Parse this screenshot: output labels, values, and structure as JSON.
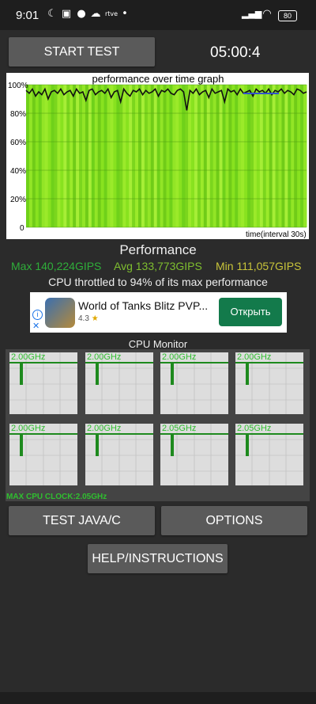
{
  "status_bar": {
    "time": "9:01",
    "battery": "80"
  },
  "buttons": {
    "start_test": "START TEST",
    "test_java_c": "TEST JAVA/C",
    "options": "OPTIONS",
    "help": "HELP/INSTRUCTIONS"
  },
  "timer": "05:00:4",
  "graph": {
    "title": "performance over time graph",
    "y_ticks": [
      "100%",
      "80%",
      "60%",
      "40%",
      "20%",
      "0"
    ],
    "x_label": "time(interval 30s)"
  },
  "performance": {
    "title": "Performance",
    "max": "Max 140,224GIPS",
    "avg": "Avg 133,773GIPS",
    "min": "Min 111,057GIPS",
    "throttle": "CPU throttled to 94% of its max performance",
    "colors": {
      "max": "#2fae3a",
      "avg": "#7fbf2f",
      "min": "#c8c43a"
    }
  },
  "ad": {
    "title": "World of Tanks Blitz PVP...",
    "rating": "4.3",
    "button": "Открыть"
  },
  "cpu_monitor": {
    "title": "CPU Monitor",
    "cores": [
      {
        "freq": "2.00GHz"
      },
      {
        "freq": "2.00GHz"
      },
      {
        "freq": "2.00GHz"
      },
      {
        "freq": "2.00GHz"
      },
      {
        "freq": "2.00GHz"
      },
      {
        "freq": "2.00GHz"
      },
      {
        "freq": "2.05GHz"
      },
      {
        "freq": "2.05GHz"
      }
    ],
    "max_clock": "MAX CPU CLOCK:2.05GHz"
  },
  "chart_data": {
    "type": "line",
    "title": "performance over time graph",
    "xlabel": "time(interval 30s)",
    "ylabel": "",
    "ylim": [
      0,
      100
    ],
    "y_ticks": [
      "100%",
      "80%",
      "60%",
      "40%",
      "20%",
      "0"
    ],
    "series": [
      {
        "values": [
          96,
          94,
          97,
          92,
          95,
          93,
          97,
          90,
          95,
          96,
          94,
          97,
          93,
          95,
          96,
          92,
          97,
          94,
          95,
          89,
          96,
          97,
          93,
          95,
          96,
          94,
          97,
          91,
          95,
          96,
          88,
          97,
          94,
          92,
          96,
          95,
          97,
          93,
          96,
          94,
          95,
          97,
          92,
          96,
          95,
          97,
          94,
          93,
          96,
          97,
          95,
          82,
          96,
          94,
          97,
          93,
          95,
          96,
          91,
          97,
          94,
          95,
          96,
          88,
          97,
          95,
          96,
          93,
          97,
          94,
          95,
          96,
          92,
          97,
          95,
          96,
          94,
          97,
          93,
          96,
          95,
          97,
          94,
          96,
          95,
          93,
          97,
          96,
          94,
          95
        ]
      }
    ]
  }
}
